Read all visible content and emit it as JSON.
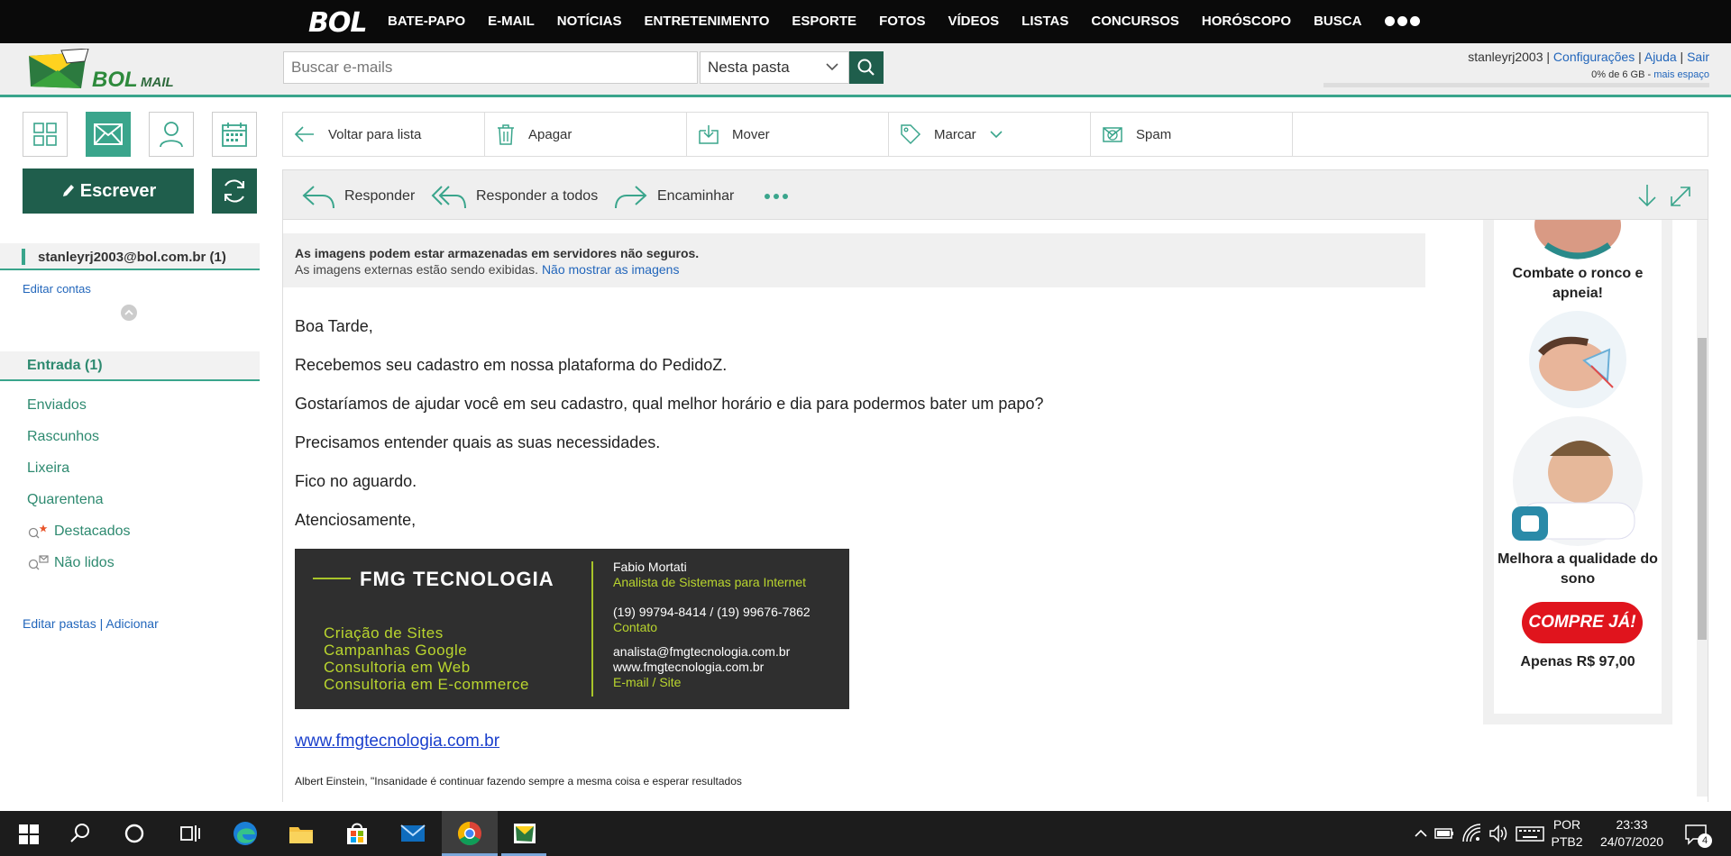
{
  "topnav": {
    "logo": "BOL",
    "items": [
      "BATE-PAPO",
      "E-MAIL",
      "NOTÍCIAS",
      "ENTRETENIMENTO",
      "ESPORTE",
      "FOTOS",
      "VÍDEOS",
      "LISTAS",
      "CONCURSOS",
      "HORÓSCOPO",
      "BUSCA"
    ]
  },
  "header": {
    "brand": "BOL",
    "brand_suffix": "MAIL",
    "search_placeholder": "Buscar e-mails",
    "scope": "Nesta pasta",
    "user": "stanleyrj2003",
    "links": [
      "Configurações",
      "Ajuda",
      "Sair"
    ],
    "quota": "0% de 6 GB",
    "more_space": "mais espaço"
  },
  "sidebar": {
    "compose": "Escrever",
    "account": "stanleyrj2003@bol.com.br (1)",
    "edit_accounts": "Editar contas",
    "inbox": "Entrada (1)",
    "folders": [
      "Enviados",
      "Rascunhos",
      "Lixeira",
      "Quarentena",
      "Destacados",
      "Não lidos"
    ],
    "edit_folders": "Editar pastas",
    "add": "Adicionar"
  },
  "toolbar": {
    "back": "Voltar para lista",
    "delete": "Apagar",
    "move": "Mover",
    "mark": "Marcar",
    "spam": "Spam"
  },
  "actions": {
    "reply": "Responder",
    "reply_all": "Responder a todos",
    "forward": "Encaminhar"
  },
  "email": {
    "warning_title": "As imagens podem estar armazenadas em servidores não seguros.",
    "warning_text": "As imagens externas estão sendo exibidas.",
    "warning_link": "Não mostrar as imagens",
    "lines": [
      "Boa Tarde,",
      "Recebemos seu cadastro em nossa plataforma do PedidoZ.",
      "Gostaríamos de ajudar você em seu cadastro, qual melhor horário e dia para podermos bater um papo?",
      "Precisamos entender quais as suas necessidades.",
      "Fico no aguardo.",
      "Atenciosamente,"
    ],
    "signature": {
      "brand": "FMG TECNOLOGIA",
      "services": [
        "Criação de Sites",
        "Campanhas Google",
        "Consultoria em Web",
        "Consultoria em E-commerce"
      ],
      "name": "Fabio Mortati",
      "role": "Analista de Sistemas para Internet",
      "phones": "(19) 99794-8414 / (19) 99676-7862",
      "contact_label": "Contato",
      "email": "analista@fmgtecnologia.com.br",
      "site": "www.fmgtecnologia.com.br",
      "email_site_label": "E-mail / Site"
    },
    "link": "www.fmgtecnologia.com.br",
    "quote": "Albert Einstein, \"Insanidade é continuar fazendo sempre a mesma coisa e esperar resultados"
  },
  "ad": {
    "caption1": "Combate o ronco e apneia!",
    "caption2": "Melhora a qualidade do sono",
    "button": "COMPRE JÁ!",
    "price": "Apenas R$ 97,00"
  },
  "taskbar": {
    "lang1": "POR",
    "lang2": "PTB2",
    "time": "23:33",
    "date": "24/07/2020",
    "notifications": "4"
  },
  "colors": {
    "accent": "#3aa58c",
    "dark_green": "#1f5e4c",
    "link": "#2266bb"
  }
}
